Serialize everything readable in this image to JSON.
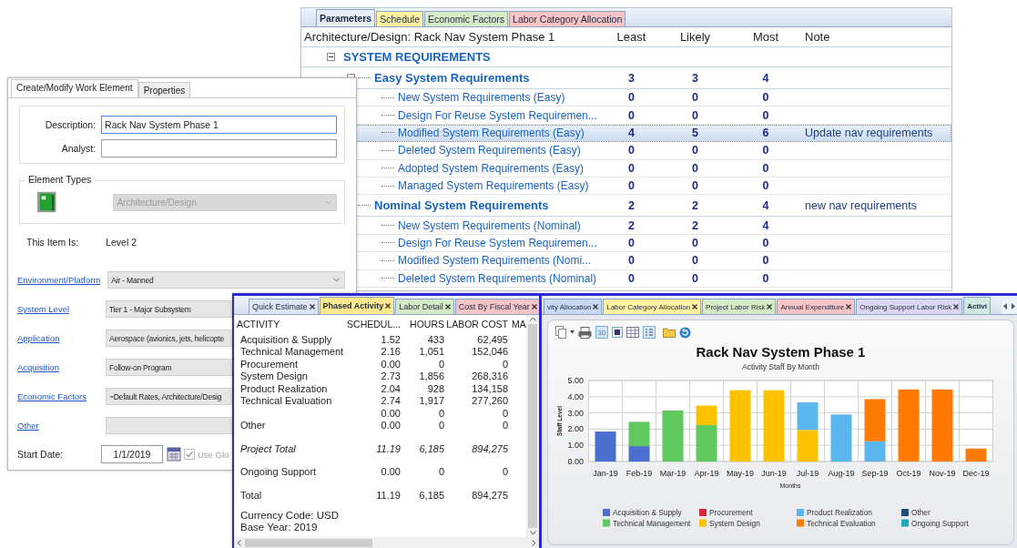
{
  "parameters_window": {
    "tabs": [
      {
        "label": "Parameters",
        "color": "#e6ecf5",
        "selected": true,
        "closable": false
      },
      {
        "label": "Schedule",
        "color": "#fff2a0",
        "selected": false,
        "closable": false
      },
      {
        "label": "Economic Factors",
        "color": "#d4ebc6",
        "selected": false,
        "closable": false
      },
      {
        "label": "Labor Category Allocation",
        "color": "#f6c4c4",
        "selected": false,
        "closable": false
      }
    ],
    "header": {
      "name": "Architecture/Design: Rack Nav System Phase 1",
      "least": "Least",
      "likely": "Likely",
      "most": "Most",
      "note": "Note"
    },
    "tree": [
      {
        "kind": "section",
        "label": "SYSTEM REQUIREMENTS",
        "expanded": true,
        "selected": false,
        "children": [
          {
            "kind": "group",
            "label": "Easy System Requirements",
            "least": "3",
            "likely": "3",
            "most": "4",
            "expanded": true,
            "selected": false,
            "children": [
              {
                "kind": "leaf",
                "label": "New System Requirements (Easy)",
                "least": "0",
                "likely": "0",
                "most": "0",
                "selected": false
              },
              {
                "kind": "leaf",
                "label": "Design For Reuse System Requiremen...",
                "least": "0",
                "likely": "0",
                "most": "0",
                "selected": false
              },
              {
                "kind": "leaf",
                "label": "Modified System Requirements (Easy)",
                "least": "4",
                "likely": "5",
                "most": "6",
                "note": "Update nav requirements",
                "selected": true
              },
              {
                "kind": "leaf",
                "label": "Deleted System Requirements (Easy)",
                "least": "0",
                "likely": "0",
                "most": "0",
                "selected": false
              },
              {
                "kind": "leaf",
                "label": "Adopted System Requirements (Easy)",
                "least": "0",
                "likely": "0",
                "most": "0",
                "selected": false
              },
              {
                "kind": "leaf",
                "label": "Managed System Requirements (Easy)",
                "least": "0",
                "likely": "0",
                "most": "0",
                "selected": false
              }
            ]
          },
          {
            "kind": "group",
            "label": "Nominal System Requirements",
            "least": "2",
            "likely": "2",
            "most": "4",
            "note": "new nav requirements",
            "expanded": true,
            "selected": false,
            "children": [
              {
                "kind": "leaf",
                "label": "New System Requirements (Nominal)",
                "least": "2",
                "likely": "2",
                "most": "4",
                "selected": false
              },
              {
                "kind": "leaf",
                "label": "Design For Reuse System Requiremen...",
                "least": "0",
                "likely": "0",
                "most": "0",
                "selected": false
              },
              {
                "kind": "leaf",
                "label": "Modified System Requirements (Nomi...",
                "least": "0",
                "likely": "0",
                "most": "0",
                "selected": false
              },
              {
                "kind": "leaf",
                "label": "Deleted System Requirements (Nominal)",
                "least": "0",
                "likely": "0",
                "most": "0",
                "selected": false
              }
            ]
          }
        ]
      }
    ]
  },
  "work_element_window": {
    "tabs": [
      {
        "label": "Create/Modify Work Element",
        "selected": true
      },
      {
        "label": "Properties",
        "selected": false
      }
    ],
    "description": {
      "label": "Description:",
      "value": "Rack Nav System Phase 1"
    },
    "analyst": {
      "label": "Analyst:"
    },
    "element_types": {
      "legend": "Element Types",
      "value": "Architecture/Design",
      "disabled": true
    },
    "item_level": {
      "label": "This Item Is:",
      "value": "Level 2"
    },
    "links": [
      {
        "label": "Environment/Platform",
        "value": "Air - Manned"
      },
      {
        "label": "System Level",
        "value": "Tier 1 - Major Subsystem"
      },
      {
        "label": "Application",
        "value": "Aerospace (avionics, jets, helicopte"
      },
      {
        "label": "Acquisition",
        "value": "Follow-on Program"
      },
      {
        "label": "Economic Factors",
        "value": "~Default Rates, Architecture/Desig"
      },
      {
        "label": "Other"
      }
    ],
    "start_date": {
      "label": "Start Date:",
      "value": "1/1/2019"
    },
    "use_global": {
      "label": "Use Glo",
      "checked": true,
      "disabled": true
    }
  },
  "phased_activity_window": {
    "tabs": [
      {
        "label": "Quick Estimate",
        "color": "#dbe5f3",
        "selected": false,
        "closable": true
      },
      {
        "label": "Phased Activity",
        "color": "#ffe890",
        "selected": true,
        "closable": true
      },
      {
        "label": "Labor Detail",
        "color": "#d4ebc6",
        "selected": false,
        "closable": true
      },
      {
        "label": "Cost By Fiscal Year",
        "color": "#f6c4c4",
        "selected": false,
        "closable": true
      }
    ],
    "columns": [
      "ACTIVITY",
      "SCHEDUL...",
      "HOURS",
      "LABOR COST",
      "MA"
    ],
    "rows": [
      {
        "kind": "activity",
        "activity": "Acquisition & Supply",
        "schedule": "1.52",
        "hours": "433",
        "labor_cost": "62,495"
      },
      {
        "kind": "activity",
        "activity": "Technical Management",
        "schedule": "2.16",
        "hours": "1,051",
        "labor_cost": "152,046"
      },
      {
        "kind": "activity",
        "activity": "Procurement",
        "schedule": "0.00",
        "hours": "0",
        "labor_cost": "0"
      },
      {
        "kind": "activity",
        "activity": "System Design",
        "schedule": "2.73",
        "hours": "1,856",
        "labor_cost": "268,316"
      },
      {
        "kind": "activity",
        "activity": "Product Realization",
        "schedule": "2.04",
        "hours": "928",
        "labor_cost": "134,158"
      },
      {
        "kind": "activity",
        "activity": "Technical Evaluation",
        "schedule": "2.74",
        "hours": "1,917",
        "labor_cost": "277,260"
      },
      {
        "kind": "activity",
        "schedule": "0.00",
        "hours": "0",
        "labor_cost": "0"
      },
      {
        "kind": "activity",
        "activity": "Other",
        "schedule": "0.00",
        "hours": "0",
        "labor_cost": "0"
      },
      {
        "kind": "subtotal",
        "activity": "Project Total",
        "schedule": "11.19",
        "hours": "6,185",
        "labor_cost": "894,275"
      },
      {
        "kind": "summary",
        "activity": "Ongoing Support",
        "schedule": "0.00",
        "hours": "0",
        "labor_cost": "0"
      },
      {
        "kind": "summary",
        "activity": "Total",
        "schedule": "11.19",
        "hours": "6,185",
        "labor_cost": "894,275"
      }
    ],
    "footer": [
      "Currency Code: USD",
      "Base Year: 2019"
    ]
  },
  "chart_window": {
    "tabs": [
      {
        "label": "vity Allocation",
        "color": "#c9d8f2",
        "selected": false,
        "closable": true
      },
      {
        "label": "Labor Category Allocation",
        "color": "#fff2a0",
        "selected": false,
        "closable": true
      },
      {
        "label": "Project Labor Risk",
        "color": "#d4ebc6",
        "selected": false,
        "closable": true
      },
      {
        "label": "Annual Expenditure",
        "color": "#f6c4c4",
        "selected": false,
        "closable": true
      },
      {
        "label": "Ongoing Support Labor Risk",
        "color": "#ddd6f2",
        "selected": false,
        "closable": true
      },
      {
        "label": "Activi",
        "color": "#cfe8e0",
        "selected": true,
        "closable": false
      }
    ],
    "toolbar_label": "3D",
    "subtitle": "Activity Staff By Month",
    "chart_data": {
      "type": "bar",
      "stacked": true,
      "title": "Rack Nav System Phase 1",
      "xlabel": "Months",
      "ylabel": "Staff Level",
      "categories": [
        "Jan-19",
        "Feb-19",
        "Mar-19",
        "Apr-19",
        "May-19",
        "Jun-19",
        "Jul-19",
        "Aug-19",
        "Sep-19",
        "Oct-19",
        "Nov-19",
        "Dec-19"
      ],
      "ylim": [
        0,
        5
      ],
      "grid": true,
      "legend": true,
      "yticks": [
        {
          "value": 0,
          "label": "0.00"
        },
        {
          "value": 1,
          "label": "1.00"
        },
        {
          "value": 2,
          "label": "2.00"
        },
        {
          "value": 3,
          "label": "3.00"
        },
        {
          "value": 4,
          "label": "4.00"
        },
        {
          "value": 5,
          "label": "5.00"
        }
      ],
      "series": [
        {
          "name": "Acquisition & Supply",
          "color": "#4a6fd0",
          "values": [
            1.85,
            0.95,
            0,
            0,
            0,
            0,
            0,
            0,
            0,
            0,
            0,
            0
          ]
        },
        {
          "name": "Technical Management",
          "color": "#5fc85f",
          "values": [
            0,
            1.5,
            3.15,
            2.25,
            0,
            0,
            0,
            0,
            0,
            0,
            0,
            0
          ]
        },
        {
          "name": "Procurement",
          "color": "#d9263a",
          "values": [
            0,
            0,
            0,
            0,
            0,
            0,
            0,
            0,
            0,
            0,
            0,
            0
          ]
        },
        {
          "name": "System Design",
          "color": "#fcc200",
          "values": [
            0,
            0,
            0,
            1.2,
            4.4,
            4.4,
            1.95,
            0,
            0,
            0,
            0,
            0
          ]
        },
        {
          "name": "Product Realization",
          "color": "#5cb6ee",
          "values": [
            0,
            0,
            0,
            0,
            0,
            0,
            1.7,
            2.9,
            1.25,
            0,
            0,
            0
          ]
        },
        {
          "name": "Technical Evaluation",
          "color": "#ff7a00",
          "values": [
            0,
            0,
            0,
            0,
            0,
            0,
            0,
            0,
            2.6,
            4.45,
            4.45,
            0.8
          ]
        },
        {
          "name": "Other",
          "color": "#1f4f7a",
          "values": [
            0,
            0,
            0,
            0,
            0,
            0,
            0,
            0,
            0,
            0,
            0,
            0
          ]
        },
        {
          "name": "Ongoing Support",
          "color": "#1aa8b8",
          "values": [
            0,
            0,
            0,
            0,
            0,
            0,
            0,
            0,
            0,
            0,
            0,
            0
          ]
        }
      ]
    }
  }
}
